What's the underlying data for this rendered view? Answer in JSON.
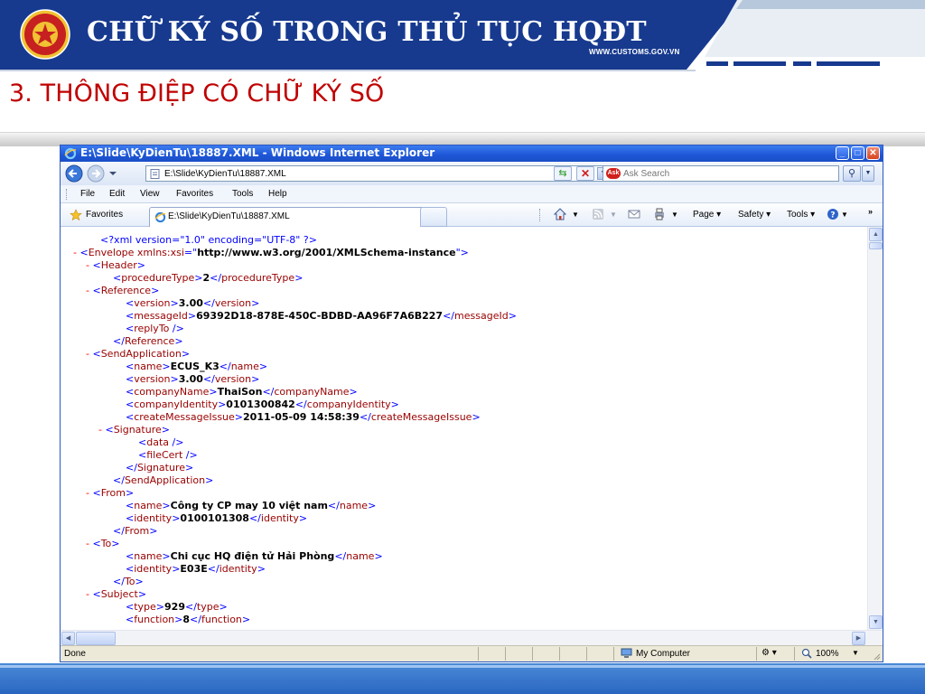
{
  "slide": {
    "title": "CHỮ KÝ SỐ TRONG THỦ TỤC HQĐT",
    "website": "WWW.CUSTOMS.GOV.VN",
    "section_title": "3. THÔNG ĐIỆP CÓ CHỮ KÝ SỐ"
  },
  "browser": {
    "title": "E:\\Slide\\KyDienTu\\18887.XML - Windows Internet Explorer",
    "address": "E:\\Slide\\KyDienTu\\18887.XML",
    "search_placeholder": "Ask Search",
    "menu": [
      "File",
      "Edit",
      "View",
      "Favorites",
      "Tools",
      "Help"
    ],
    "favorites_label": "Favorites",
    "tab_label": "E:\\Slide\\KyDienTu\\18887.XML",
    "commands": {
      "page": "Page ▾",
      "safety": "Safety ▾",
      "tools": "Tools ▾"
    },
    "status": {
      "left": "Done",
      "zone": "My Computer",
      "zoom": "100%"
    }
  },
  "xml_lines": [
    {
      "indent": 1,
      "minus": false,
      "kind": "pi",
      "text": "<?xml version=\"1.0\" encoding=\"UTF-8\" ?>"
    },
    {
      "indent": 0,
      "minus": true,
      "kind": "open_attr",
      "name": "Envelope",
      "attr_name": "xmlns:xsi",
      "attr_value": "http://www.w3.org/2001/XMLSchema-instance"
    },
    {
      "indent": 1,
      "minus": true,
      "kind": "open",
      "name": "Header"
    },
    {
      "indent": 2,
      "minus": false,
      "kind": "elem",
      "name": "procedureType",
      "value": "2"
    },
    {
      "indent": 1,
      "minus": true,
      "kind": "open",
      "name": "Reference"
    },
    {
      "indent": 3,
      "minus": false,
      "kind": "elem",
      "name": "version",
      "value": "3.00"
    },
    {
      "indent": 3,
      "minus": false,
      "kind": "elem",
      "name": "messageId",
      "value": "69392D18-878E-450C-BDBD-AA96F7A6B227"
    },
    {
      "indent": 3,
      "minus": false,
      "kind": "empty",
      "name": "replyTo"
    },
    {
      "indent": 2,
      "minus": false,
      "kind": "close",
      "name": "Reference"
    },
    {
      "indent": 1,
      "minus": true,
      "kind": "open",
      "name": "SendApplication"
    },
    {
      "indent": 3,
      "minus": false,
      "kind": "elem",
      "name": "name",
      "value": "ECUS_K3"
    },
    {
      "indent": 3,
      "minus": false,
      "kind": "elem",
      "name": "version",
      "value": "3.00"
    },
    {
      "indent": 3,
      "minus": false,
      "kind": "elem",
      "name": "companyName",
      "value": "ThaiSon"
    },
    {
      "indent": 3,
      "minus": false,
      "kind": "elem",
      "name": "companyIdentity",
      "value": "0101300842"
    },
    {
      "indent": 3,
      "minus": false,
      "kind": "elem",
      "name": "createMessageIssue",
      "value": "2011-05-09 14:58:39"
    },
    {
      "indent": 2,
      "minus": true,
      "kind": "open",
      "name": "Signature"
    },
    {
      "indent": 4,
      "minus": false,
      "kind": "empty",
      "name": "data"
    },
    {
      "indent": 4,
      "minus": false,
      "kind": "empty",
      "name": "fileCert"
    },
    {
      "indent": 3,
      "minus": false,
      "kind": "close",
      "name": "Signature"
    },
    {
      "indent": 2,
      "minus": false,
      "kind": "close",
      "name": "SendApplication"
    },
    {
      "indent": 1,
      "minus": true,
      "kind": "open",
      "name": "From"
    },
    {
      "indent": 3,
      "minus": false,
      "kind": "elem",
      "name": "name",
      "value": "Công ty CP may 10 việt nam"
    },
    {
      "indent": 3,
      "minus": false,
      "kind": "elem",
      "name": "identity",
      "value": "0100101308"
    },
    {
      "indent": 2,
      "minus": false,
      "kind": "close",
      "name": "From"
    },
    {
      "indent": 1,
      "minus": true,
      "kind": "open",
      "name": "To"
    },
    {
      "indent": 3,
      "minus": false,
      "kind": "elem",
      "name": "name",
      "value": "Chi cục HQ điện tử Hải Phòng"
    },
    {
      "indent": 3,
      "minus": false,
      "kind": "elem",
      "name": "identity",
      "value": "E03E"
    },
    {
      "indent": 2,
      "minus": false,
      "kind": "close",
      "name": "To"
    },
    {
      "indent": 1,
      "minus": true,
      "kind": "open",
      "name": "Subject"
    },
    {
      "indent": 3,
      "minus": false,
      "kind": "elem",
      "name": "type",
      "value": "929"
    },
    {
      "indent": 3,
      "minus": false,
      "kind": "elem",
      "name": "function",
      "value": "8"
    }
  ],
  "colors": {
    "header_navy": "#173a8f",
    "title_red": "#c00000",
    "xml_markup": "#0000ff",
    "xml_tag": "#990000",
    "xml_minus": "#ff0000",
    "ie_title_blue": "#1d55d6"
  },
  "icons": [
    "customs-emblem-icon",
    "ie-logo-icon",
    "back-arrow-icon",
    "forward-arrow-icon",
    "refresh-icon",
    "stop-icon",
    "search-icon",
    "favorites-star-icon",
    "home-icon",
    "feeds-icon",
    "mail-icon",
    "print-icon",
    "help-icon",
    "computer-icon",
    "zoom-icon"
  ]
}
